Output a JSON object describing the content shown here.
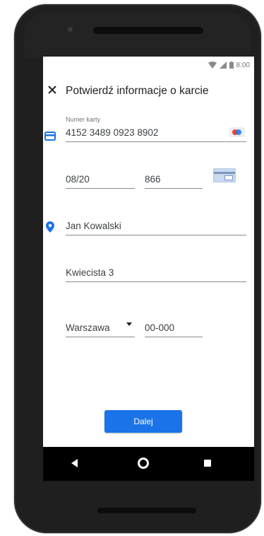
{
  "status_bar": {
    "time": "8:00"
  },
  "header": {
    "title": "Potwierdź informacje o karcie"
  },
  "card": {
    "number_label": "Numer karty",
    "number": "4152 3489 0923 8902",
    "expiry": "08/20",
    "cvc": "866"
  },
  "address": {
    "name": "Jan Kowalski",
    "street": "Kwiecista 3",
    "city": "Warszawa",
    "postal_code": "00-000"
  },
  "actions": {
    "next_label": "Dalej"
  },
  "colors": {
    "accent": "#1a73e8",
    "text": "#202124",
    "field_text": "#3c4043"
  },
  "icons": [
    "close-icon",
    "credit-card-icon",
    "mastercard-icon",
    "cvc-card-icon",
    "location-pin-icon",
    "dropdown-arrow-icon",
    "back-icon",
    "home-icon",
    "recents-icon"
  ]
}
